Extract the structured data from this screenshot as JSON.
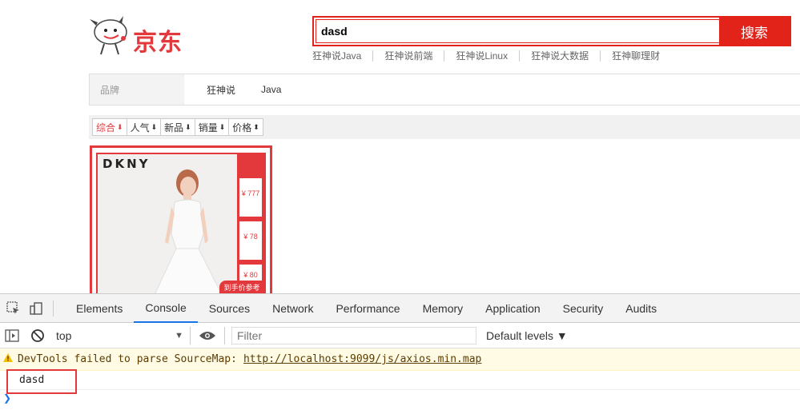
{
  "header": {
    "logo_text": "京东",
    "search_value": "dasd",
    "search_button": "搜索",
    "hot_words": [
      "狂神说Java",
      "狂神说前端",
      "狂神说Linux",
      "狂神说大数据",
      "狂神聊理财"
    ]
  },
  "filters": {
    "brand_label": "品牌",
    "brand_options": [
      "狂神说",
      "Java"
    ]
  },
  "sort": {
    "items": [
      {
        "label": "综合",
        "arrow": "⬇",
        "active": true
      },
      {
        "label": "人气",
        "arrow": "⬇"
      },
      {
        "label": "新品",
        "arrow": "⬇"
      },
      {
        "label": "销量",
        "arrow": "⬇"
      },
      {
        "label": "价格",
        "arrow": "⬍"
      }
    ]
  },
  "product": {
    "brand": "DKNY",
    "prices": [
      "777",
      "78",
      "80"
    ],
    "price_currency": "¥",
    "bottom_tag": "到手价参考"
  },
  "devtools": {
    "tabs": [
      "Elements",
      "Console",
      "Sources",
      "Network",
      "Performance",
      "Memory",
      "Application",
      "Security",
      "Audits"
    ],
    "active_tab": "Console",
    "context": "top",
    "filter_placeholder": "Filter",
    "levels": "Default levels ▼",
    "warning_text": "DevTools failed to parse SourceMap:",
    "warning_link": "http://localhost:9099/js/axios.min.map",
    "log_value": "dasd",
    "colors": {
      "accent": "#1a73e8",
      "warn_bg": "#fffbe5",
      "brand_red": "#e4393c"
    }
  }
}
